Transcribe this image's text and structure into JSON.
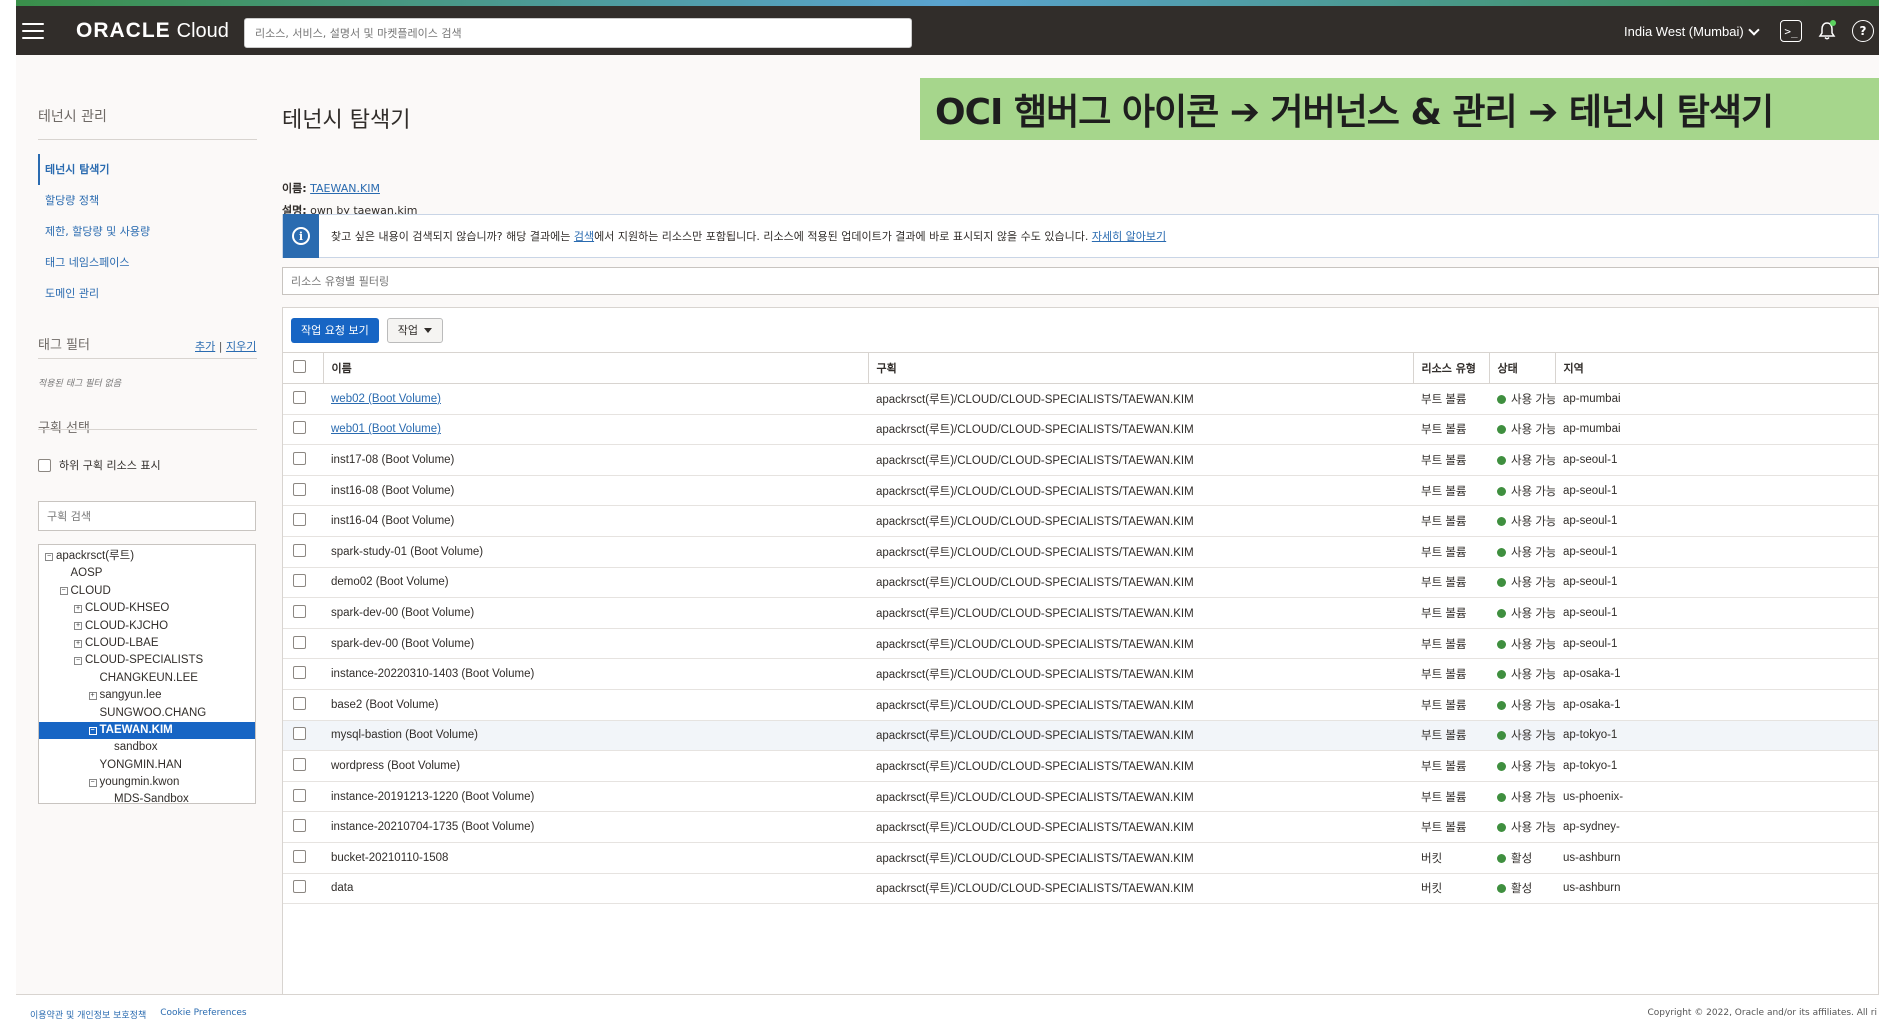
{
  "topbar": {
    "brand_oracle": "ORACLE",
    "brand_cloud": "Cloud",
    "search_placeholder": "리소스, 서비스, 설명서 및 마켓플레이스 검색",
    "region": "India West (Mumbai)"
  },
  "sidebar": {
    "title": "테넌시 관리",
    "nav": [
      {
        "label": "테넌시 탐색기",
        "active": true
      },
      {
        "label": "할당량 정책",
        "active": false
      },
      {
        "label": "제한, 할당량 및 사용량",
        "active": false
      },
      {
        "label": "태그 네임스페이스",
        "active": false
      },
      {
        "label": "도메인 관리",
        "active": false
      }
    ],
    "tag_filter_title": "태그 필터",
    "tag_add": "추가",
    "tag_sep": " | ",
    "tag_clear": "지우기",
    "tag_empty": "적용된 태그 필터 없음",
    "compartment_title": "구획 선택",
    "child_resources_label": "하위 구획 리소스 표시",
    "compartment_search_placeholder": "구획 검색",
    "tree": [
      {
        "label": "apackrsct(루트)",
        "level": 0,
        "toggle": "⊟",
        "selected": false
      },
      {
        "label": "AOSP",
        "level": 1,
        "toggle": "",
        "selected": false
      },
      {
        "label": "CLOUD",
        "level": 1,
        "toggle": "⊟",
        "selected": false
      },
      {
        "label": "CLOUD-KHSEO",
        "level": 2,
        "toggle": "⊞",
        "selected": false
      },
      {
        "label": "CLOUD-KJCHO",
        "level": 2,
        "toggle": "⊞",
        "selected": false
      },
      {
        "label": "CLOUD-LBAE",
        "level": 2,
        "toggle": "⊞",
        "selected": false
      },
      {
        "label": "CLOUD-SPECIALISTS",
        "level": 2,
        "toggle": "⊟",
        "selected": false
      },
      {
        "label": "CHANGKEUN.LEE",
        "level": 3,
        "toggle": "",
        "selected": false
      },
      {
        "label": "sangyun.lee",
        "level": 3,
        "toggle": "⊞",
        "selected": false
      },
      {
        "label": "SUNGWOO.CHANG",
        "level": 3,
        "toggle": "",
        "selected": false
      },
      {
        "label": "TAEWAN.KIM",
        "level": 3,
        "toggle": "⊟",
        "selected": true
      },
      {
        "label": "sandbox",
        "level": 4,
        "toggle": "",
        "selected": false
      },
      {
        "label": "YONGMIN.HAN",
        "level": 3,
        "toggle": "",
        "selected": false
      },
      {
        "label": "youngmin.kwon",
        "level": 3,
        "toggle": "⊟",
        "selected": false
      },
      {
        "label": "MDS-Sandbox",
        "level": 4,
        "toggle": "",
        "selected": false
      }
    ]
  },
  "main": {
    "title": "테넌시 탐색기",
    "banner": "OCI 햄버그 아이콘 ➔ 거버넌스 & 관리 ➔ 테넌시 탐색기",
    "name_label": "이름:",
    "name_value": "TAEWAN.KIM",
    "desc_label": "설명:",
    "desc_value": "own by taewan.kim",
    "info_part1": "찾고 싶은 내용이 검색되지 않습니까? 해당 결과에는 ",
    "info_link1": "검색",
    "info_part2": "에서 지원하는 리소스만 포함됩니다. 리소스에 적용된 업데이트가 결과에 바로 표시되지 않을 수도 있습니다. ",
    "info_link2": "자세히 알아보기",
    "filter_placeholder": "리소스 유형별 필터링",
    "btn_view_requests": "작업 요청 보기",
    "btn_actions": "작업",
    "columns": {
      "name": "이름",
      "compartment": "구획",
      "type": "리소스 유형",
      "state": "상태",
      "region": "지역"
    },
    "rows": [
      {
        "name": "web02 (Boot Volume)",
        "link": true,
        "compartment": "apackrsct(루트)/CLOUD/CLOUD-SPECIALISTS/TAEWAN.KIM",
        "type": "부트 볼륨",
        "state": "사용 가능",
        "region": "ap-mumbai"
      },
      {
        "name": "web01 (Boot Volume)",
        "link": true,
        "compartment": "apackrsct(루트)/CLOUD/CLOUD-SPECIALISTS/TAEWAN.KIM",
        "type": "부트 볼륨",
        "state": "사용 가능",
        "region": "ap-mumbai"
      },
      {
        "name": "inst17-08 (Boot Volume)",
        "link": false,
        "compartment": "apackrsct(루트)/CLOUD/CLOUD-SPECIALISTS/TAEWAN.KIM",
        "type": "부트 볼륨",
        "state": "사용 가능",
        "region": "ap-seoul-1"
      },
      {
        "name": "inst16-08 (Boot Volume)",
        "link": false,
        "compartment": "apackrsct(루트)/CLOUD/CLOUD-SPECIALISTS/TAEWAN.KIM",
        "type": "부트 볼륨",
        "state": "사용 가능",
        "region": "ap-seoul-1"
      },
      {
        "name": "inst16-04 (Boot Volume)",
        "link": false,
        "compartment": "apackrsct(루트)/CLOUD/CLOUD-SPECIALISTS/TAEWAN.KIM",
        "type": "부트 볼륨",
        "state": "사용 가능",
        "region": "ap-seoul-1"
      },
      {
        "name": "spark-study-01 (Boot Volume)",
        "link": false,
        "compartment": "apackrsct(루트)/CLOUD/CLOUD-SPECIALISTS/TAEWAN.KIM",
        "type": "부트 볼륨",
        "state": "사용 가능",
        "region": "ap-seoul-1"
      },
      {
        "name": "demo02 (Boot Volume)",
        "link": false,
        "compartment": "apackrsct(루트)/CLOUD/CLOUD-SPECIALISTS/TAEWAN.KIM",
        "type": "부트 볼륨",
        "state": "사용 가능",
        "region": "ap-seoul-1"
      },
      {
        "name": "spark-dev-00 (Boot Volume)",
        "link": false,
        "compartment": "apackrsct(루트)/CLOUD/CLOUD-SPECIALISTS/TAEWAN.KIM",
        "type": "부트 볼륨",
        "state": "사용 가능",
        "region": "ap-seoul-1"
      },
      {
        "name": "spark-dev-00 (Boot Volume)",
        "link": false,
        "compartment": "apackrsct(루트)/CLOUD/CLOUD-SPECIALISTS/TAEWAN.KIM",
        "type": "부트 볼륨",
        "state": "사용 가능",
        "region": "ap-seoul-1"
      },
      {
        "name": "instance-20220310-1403 (Boot Volume)",
        "link": false,
        "compartment": "apackrsct(루트)/CLOUD/CLOUD-SPECIALISTS/TAEWAN.KIM",
        "type": "부트 볼륨",
        "state": "사용 가능",
        "region": "ap-osaka-1"
      },
      {
        "name": "base2 (Boot Volume)",
        "link": false,
        "compartment": "apackrsct(루트)/CLOUD/CLOUD-SPECIALISTS/TAEWAN.KIM",
        "type": "부트 볼륨",
        "state": "사용 가능",
        "region": "ap-osaka-1"
      },
      {
        "name": "mysql-bastion (Boot Volume)",
        "link": false,
        "compartment": "apackrsct(루트)/CLOUD/CLOUD-SPECIALISTS/TAEWAN.KIM",
        "type": "부트 볼륨",
        "state": "사용 가능",
        "region": "ap-tokyo-1",
        "highlight": true
      },
      {
        "name": "wordpress (Boot Volume)",
        "link": false,
        "compartment": "apackrsct(루트)/CLOUD/CLOUD-SPECIALISTS/TAEWAN.KIM",
        "type": "부트 볼륨",
        "state": "사용 가능",
        "region": "ap-tokyo-1"
      },
      {
        "name": "instance-20191213-1220 (Boot Volume)",
        "link": false,
        "compartment": "apackrsct(루트)/CLOUD/CLOUD-SPECIALISTS/TAEWAN.KIM",
        "type": "부트 볼륨",
        "state": "사용 가능",
        "region": "us-phoenix-"
      },
      {
        "name": "instance-20210704-1735 (Boot Volume)",
        "link": false,
        "compartment": "apackrsct(루트)/CLOUD/CLOUD-SPECIALISTS/TAEWAN.KIM",
        "type": "부트 볼륨",
        "state": "사용 가능",
        "region": "ap-sydney-"
      },
      {
        "name": "bucket-20210110-1508",
        "link": false,
        "compartment": "apackrsct(루트)/CLOUD/CLOUD-SPECIALISTS/TAEWAN.KIM",
        "type": "버킷",
        "state": "활성",
        "region": "us-ashburn"
      },
      {
        "name": "data",
        "link": false,
        "compartment": "apackrsct(루트)/CLOUD/CLOUD-SPECIALISTS/TAEWAN.KIM",
        "type": "버킷",
        "state": "활성",
        "region": "us-ashburn"
      }
    ]
  },
  "footer": {
    "terms": "이용약관 및 개인정보 보호정책",
    "cookies": "Cookie Preferences",
    "copyright": "Copyright © 2022, Oracle and/or its affiliates. All ri"
  },
  "colors": {
    "primary": "#1765c4",
    "topbar": "#312d2a",
    "banner": "#a6d68c",
    "status_ok": "#3f8f3f",
    "link": "#2a6bb0"
  }
}
